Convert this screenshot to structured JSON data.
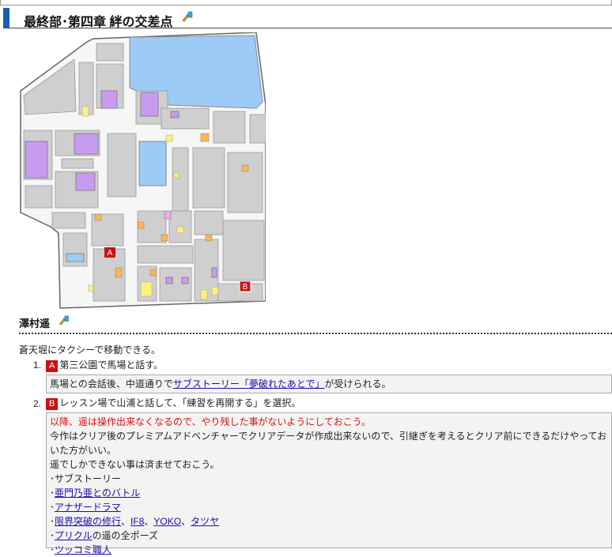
{
  "heading": {
    "title": "最終部･第四章 絆の交差点"
  },
  "map": {
    "marker_a": "A",
    "marker_b": "B"
  },
  "section": {
    "title": "澤村遥"
  },
  "intro": "蒼天堀にタクシーで移動できる。",
  "steps": [
    {
      "num": "1.",
      "tag": "A",
      "text": "第三公園で馬場と話す。",
      "note_prefix": "馬場との会話後、中道通りで",
      "note_link": "サブストーリー「夢破れたあとで」",
      "note_suffix": "が受けられる。"
    },
    {
      "num": "2.",
      "tag": "B",
      "text": "レッスン場で山浦と話して、「練習を再開する」を選択。",
      "warning": "以降、遥は操作出来なくなるので、やり残した事がないようにしておこう。",
      "line2": "今作はクリア後のプレミアムアドベンチャーでクリアデータが作成出来ないので、引継ぎを考えるとクリア前にできるだけやっておいた方がいい。",
      "line3": "遥でしかできない事は済ませておこう。",
      "items": {
        "i1": "･サブストーリー",
        "i2_pre": "･",
        "i2_link": "亜門乃亜とのバトル",
        "i3_pre": "･",
        "i3_link": "アナザードラマ",
        "i4_pre": "･",
        "i4_l1": "限界突破の修行",
        "i4_s1": "、",
        "i4_l2": "IF8",
        "i4_s2": "、",
        "i4_l3": "YOKO",
        "i4_s3": "、",
        "i4_l4": "タツヤ",
        "i5_pre": "･",
        "i5_link": "プリクル",
        "i5_suf": "の遥の全ポーズ",
        "i6_pre": "･",
        "i6_link": "ツッコミ職人"
      }
    }
  ],
  "colors": {
    "accent": "#1a5fb4",
    "marker": "#cc1111",
    "link": "#1a0dab",
    "warning": "#dd1111",
    "water": "#9ccbf7",
    "purple": "#c79cf0",
    "orange": "#ffb64f",
    "yellow": "#fff07a"
  },
  "icons": {
    "edit": "pencil-edit-icon"
  }
}
